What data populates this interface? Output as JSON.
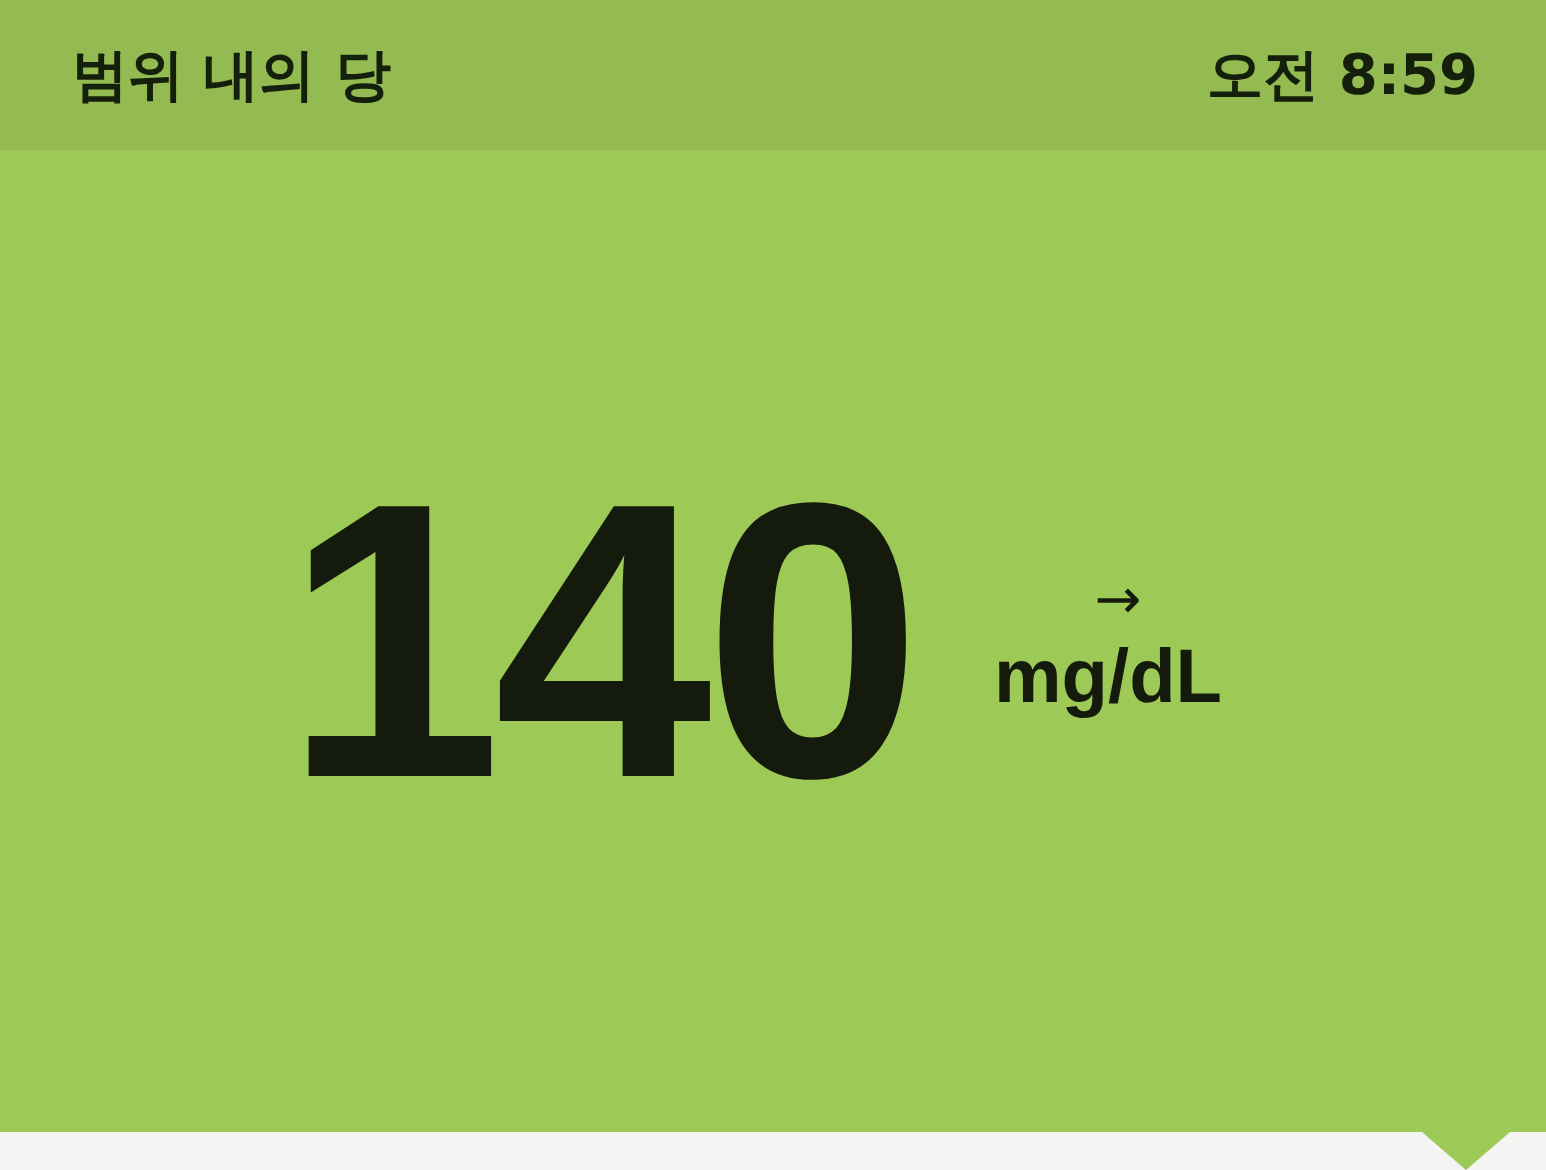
{
  "header": {
    "title": "범위 내의 당",
    "time": "오전 8:59"
  },
  "reading": {
    "value": "140",
    "trend": "→",
    "unit": "mg/dL"
  }
}
